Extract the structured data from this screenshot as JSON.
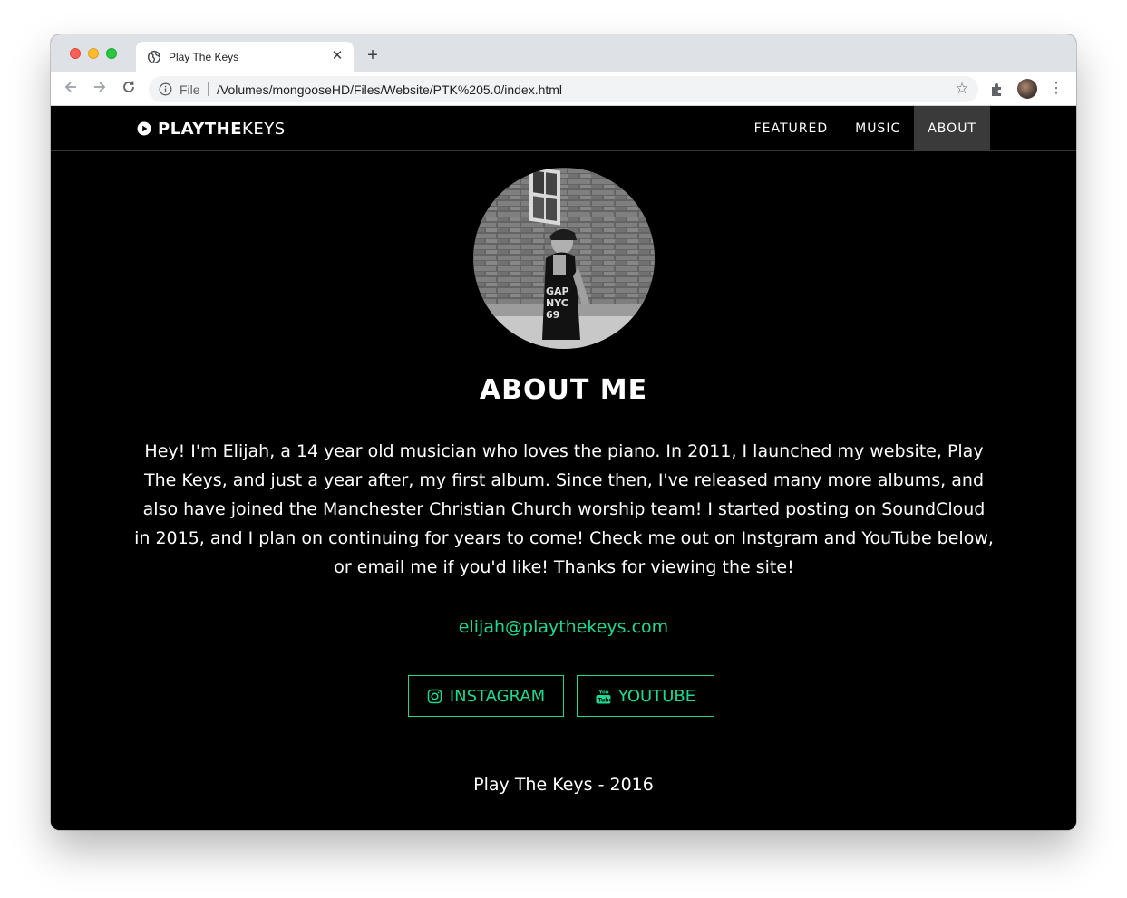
{
  "browser": {
    "tab_title": "Play The Keys",
    "tab_close": "✕",
    "new_tab": "+",
    "url_scheme": "File",
    "url": "/Volumes/mongooseHD/Files/Website/PTK%205.0/index.html"
  },
  "site": {
    "brand_bold": "PLAYTHE",
    "brand_light": "KEYS",
    "nav": [
      {
        "label": "FEATURED",
        "active": false
      },
      {
        "label": "MUSIC",
        "active": false
      },
      {
        "label": "ABOUT",
        "active": true
      }
    ],
    "heading": "ABOUT ME",
    "bio": "Hey! I'm Elijah, a 14 year old musician who loves the piano. In 2011, I launched my website, Play The Keys, and just a year after, my first album. Since then, I've released many more albums, and also have joined the Manchester Christian Church worship team! I started posting on SoundCloud in 2015, and I plan on continuing for years to come! Check me out on Instgram and YouTube below, or email me if you'd like! Thanks for viewing the site!",
    "email": "elijah@playthekeys.com",
    "buttons": {
      "instagram": "INSTAGRAM",
      "youtube": "YOUTUBE"
    },
    "footer": "Play The Keys - 2016"
  },
  "colors": {
    "accent": "#1ed98f",
    "background": "#000000",
    "nav_active": "#3a3a3a"
  }
}
